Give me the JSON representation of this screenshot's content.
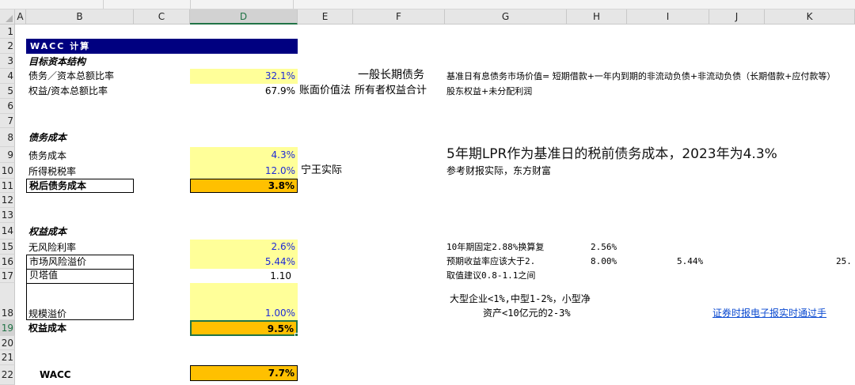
{
  "columns": [
    "A",
    "B",
    "C",
    "D",
    "E",
    "F",
    "G",
    "H",
    "I",
    "J",
    "K"
  ],
  "rows": [
    "1",
    "2",
    "3",
    "4",
    "5",
    "6",
    "7",
    "8",
    "9",
    "10",
    "11",
    "12",
    "13",
    "14",
    "15",
    "16",
    "17",
    "18",
    "19",
    "20",
    "21",
    "22"
  ],
  "selected_column": "D",
  "selected_row": "19",
  "title": "WACC  计算",
  "target_capital_structure": "目标资本结构",
  "debt_ratio_label": "债务／资本总额比率",
  "debt_ratio_value": "32.1%",
  "equity_ratio_label": "权益/资本总额比率",
  "equity_ratio_value": "67.9%",
  "e5_text": "账面价值法",
  "f4_text": "一般长期债务",
  "f5_text": "所有者权益合计",
  "g4_text": "基准日有息债务市场价值= 短期借款+一年内到期的非流动负债+非流动负债（长期借款+应付款等）",
  "g5_text": "股东权益+未分配利润",
  "debt_cost_header": "债务成本",
  "debt_cost_label": "债务成本",
  "debt_cost_value": "4.3%",
  "tax_rate_label": "所得税税率",
  "tax_rate_value": "12.0%",
  "e10_text": "宁王实际",
  "after_tax_debt_label": "税后债务成本",
  "after_tax_debt_value": "3.8%",
  "g9_text": "5年期LPR作为基准日的税前债务成本，2023年为4.3%",
  "g10_text": "参考财报实际，东方财富",
  "equity_cost_header": "权益成本",
  "risk_free_label": "无风险利率",
  "risk_free_value": "2.6%",
  "market_premium_label": "市场风险溢价",
  "market_premium_value": "5.44%",
  "beta_label": "贝塔值",
  "beta_value": "1.10",
  "size_premium_label": "规模溢价",
  "size_premium_value": "1.00%",
  "equity_cost_label": "权益成本",
  "equity_cost_value": "9.5%",
  "g15_text": "10年期固定2.88%换算复",
  "h15_text": "2.56%",
  "g16_text": "预期收益率应该大于2.",
  "h16_text": "8.00%",
  "i16_text": "5.44%",
  "k16_text": "25.",
  "g17_text": "取值建议0.8-1.1之间",
  "g18_line1": "大型企业<1%,中型1-2%，小型净",
  "g18_line2": "资产<10亿元的2-3%",
  "j19_link": "证券时报电子报实时通过手",
  "wacc_label": "WACC",
  "wacc_value": "7.7%",
  "colors": {
    "navy": "#000080",
    "yellow": "#ffff99",
    "orange": "#ffc000",
    "blue_text": "#1f2bd6",
    "header_gray": "#e6e6e6",
    "select_green": "#217346"
  }
}
